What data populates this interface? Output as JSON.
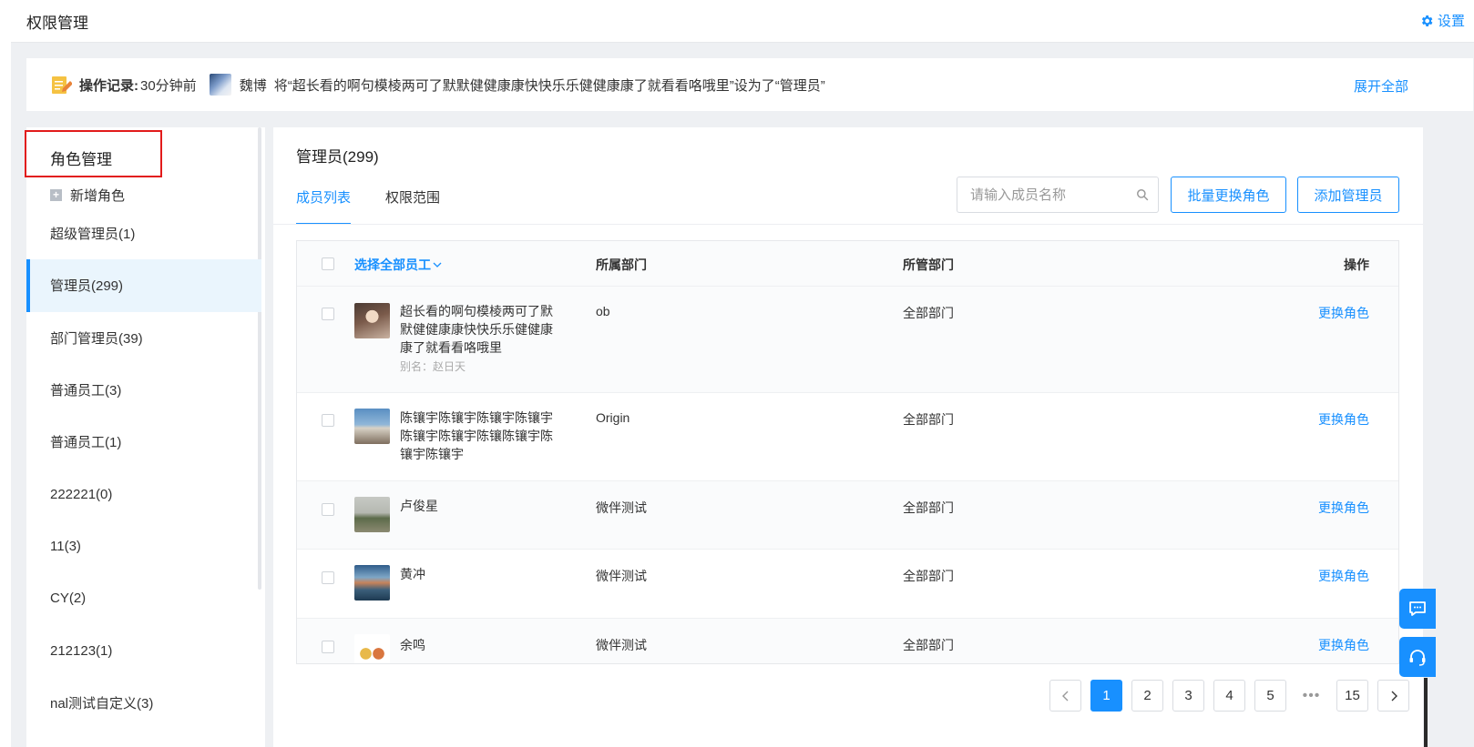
{
  "header": {
    "title": "权限管理",
    "settings_label": "设置",
    "settings_icon": "gear-icon"
  },
  "log": {
    "label": "操作记录:",
    "time": "30分钟前",
    "user": "魏博",
    "text": "将“超长看的啊句模棱两可了默默健健康康快快乐乐健健康康了就看看咯哦里”设为了“管理员”",
    "expand_label": "展开全部"
  },
  "sidebar": {
    "heading": "角色管理",
    "add_role": "新增角色",
    "items": [
      {
        "label": "超级管理员(1)"
      },
      {
        "label": "管理员(299)",
        "active": true
      },
      {
        "label": "部门管理员(39)"
      },
      {
        "label": "普通员工(3)"
      },
      {
        "label": "普通员工(1)"
      },
      {
        "label": "222221(0)"
      },
      {
        "label": "11(3)"
      },
      {
        "label": "CY(2)"
      },
      {
        "label": "212123(1)"
      },
      {
        "label": "nal测试自定义(3)"
      }
    ]
  },
  "main": {
    "title": "管理员(299)",
    "tabs": [
      {
        "label": "成员列表",
        "active": true
      },
      {
        "label": "权限范围"
      }
    ],
    "search_placeholder": "请输入成员名称",
    "batch_button": "批量更换角色",
    "add_button": "添加管理员"
  },
  "table": {
    "headers": {
      "select_all": "选择全部员工",
      "dept": "所属部门",
      "managed": "所管部门",
      "action": "操作"
    },
    "rows": [
      {
        "name": "超长看的啊句模棱两可了默默健健康康快快乐乐健健康康了就看看咯哦里",
        "alias": "别名：赵日天",
        "dept": "ob",
        "managed": "全部部门",
        "action": "更换角色"
      },
      {
        "name": "陈镶宇陈镶宇陈镶宇陈镶宇陈镶宇陈镶宇陈镶陈镶宇陈镶宇陈镶宇",
        "alias": "",
        "dept": "Origin",
        "managed": "全部部门",
        "action": "更换角色"
      },
      {
        "name": "卢俊星",
        "alias": "",
        "dept": "微伴测试",
        "managed": "全部部门",
        "action": "更换角色"
      },
      {
        "name": "黄冲",
        "alias": "",
        "dept": "微伴测试",
        "managed": "全部部门",
        "action": "更换角色"
      },
      {
        "name": "余鸣",
        "alias": "",
        "dept": "微伴测试",
        "managed": "全部部门",
        "action": "更换角色"
      }
    ]
  },
  "pagination": {
    "pages": [
      "1",
      "2",
      "3",
      "4",
      "5"
    ],
    "dots": "•••",
    "last": "15",
    "current": "1"
  },
  "colors": {
    "accent": "#1890ff",
    "highlight_box": "#e21b1b",
    "active_bg": "#eaf5fd"
  }
}
